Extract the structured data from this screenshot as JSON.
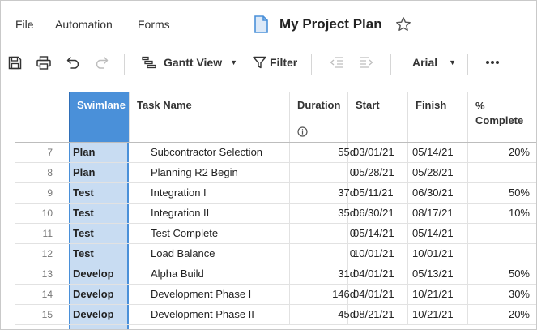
{
  "menu": {
    "file": "File",
    "automation": "Automation",
    "forms": "Forms"
  },
  "title": "My Project Plan",
  "toolbar": {
    "view_label": "Gantt View",
    "filter_label": "Filter",
    "font_label": "Arial"
  },
  "columns": {
    "swimlane": "Swimlane",
    "task": "Task Name",
    "duration": "Duration",
    "start": "Start",
    "finish": "Finish",
    "pct_1": "%",
    "pct_2": "Complete"
  },
  "rows": [
    {
      "num": "7",
      "swim": "Plan",
      "task": "Subcontractor Selection",
      "duration": "55d",
      "start": "03/01/21",
      "finish": "05/14/21",
      "pct": "20%"
    },
    {
      "num": "8",
      "swim": "Plan",
      "task": "Planning R2 Begin",
      "duration": "0",
      "start": "05/28/21",
      "finish": "05/28/21",
      "pct": ""
    },
    {
      "num": "9",
      "swim": "Test",
      "task": "Integration I",
      "duration": "37d",
      "start": "05/11/21",
      "finish": "06/30/21",
      "pct": "50%"
    },
    {
      "num": "10",
      "swim": "Test",
      "task": "Integration II",
      "duration": "35d",
      "start": "06/30/21",
      "finish": "08/17/21",
      "pct": "10%"
    },
    {
      "num": "11",
      "swim": "Test",
      "task": "Test Complete",
      "duration": "0",
      "start": "05/14/21",
      "finish": "05/14/21",
      "pct": ""
    },
    {
      "num": "12",
      "swim": "Test",
      "task": "Load Balance",
      "duration": "0",
      "start": "10/01/21",
      "finish": "10/01/21",
      "pct": ""
    },
    {
      "num": "13",
      "swim": "Develop",
      "task": "Alpha Build",
      "duration": "31d",
      "start": "04/01/21",
      "finish": "05/13/21",
      "pct": "50%"
    },
    {
      "num": "14",
      "swim": "Develop",
      "task": "Development Phase I",
      "duration": "146d",
      "start": "04/01/21",
      "finish": "10/21/21",
      "pct": "30%"
    },
    {
      "num": "15",
      "swim": "Develop",
      "task": "Development Phase II",
      "duration": "45d",
      "start": "08/21/21",
      "finish": "10/21/21",
      "pct": "20%"
    }
  ],
  "icons": [
    "document-icon",
    "star-icon",
    "save-icon",
    "print-icon",
    "undo-icon",
    "redo-icon",
    "gantt-icon",
    "filter-icon",
    "outdent-icon",
    "indent-icon",
    "more-icon",
    "info-icon"
  ],
  "colors": {
    "swimlane_header": "#4a90d9",
    "swimlane_column": "#c8dcf2",
    "doc_icon": "#4a90d9"
  }
}
